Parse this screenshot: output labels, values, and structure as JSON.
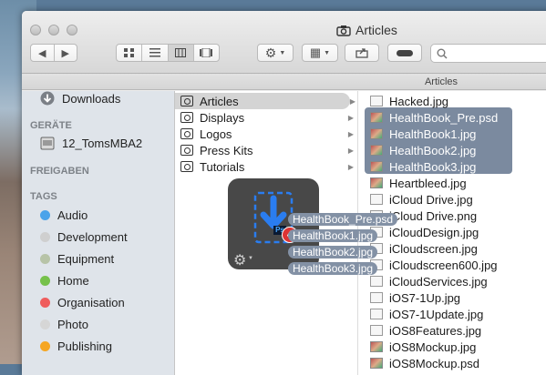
{
  "window": {
    "title": "Articles"
  },
  "toolbar": {
    "back": "◀",
    "forward": "▶",
    "gear": "⚙",
    "arrange": "▦"
  },
  "pathbar": {
    "label": "Articles"
  },
  "sidebar": {
    "top_item": {
      "label": "Downloads",
      "icon": "download-icon"
    },
    "devices_header": "GERÄTE",
    "devices": [
      {
        "label": "12_TomsMBA2",
        "icon": "harddisk-icon"
      }
    ],
    "shared_header": "FREIGABEN",
    "tags_header": "TAGS",
    "tags": [
      {
        "label": "Audio",
        "color": "#4aa3ea"
      },
      {
        "label": "Development",
        "color": "#cfcfcf"
      },
      {
        "label": "Equipment",
        "color": "#b7c3a7"
      },
      {
        "label": "Home",
        "color": "#76c14a"
      },
      {
        "label": "Organisation",
        "color": "#ef5d5d"
      },
      {
        "label": "Photo",
        "color": "#d6d6d6"
      },
      {
        "label": "Publishing",
        "color": "#f5a623"
      }
    ]
  },
  "column1": {
    "items": [
      {
        "label": "Articles",
        "selected": true
      },
      {
        "label": "Displays"
      },
      {
        "label": "Logos"
      },
      {
        "label": "Press Kits"
      },
      {
        "label": "Tutorials"
      }
    ]
  },
  "column2": {
    "items": [
      {
        "label": "Hacked.jpg"
      },
      {
        "label": "HealthBook_Pre.psd",
        "selected": true
      },
      {
        "label": "HealthBook1.jpg",
        "selected": true
      },
      {
        "label": "HealthBook2.jpg",
        "selected": true
      },
      {
        "label": "HealthBook3.jpg",
        "selected": true
      },
      {
        "label": "Heartbleed.jpg"
      },
      {
        "label": "iCloud Drive.jpg"
      },
      {
        "label": "iCloud Drive.png"
      },
      {
        "label": "iCloudDesign.jpg"
      },
      {
        "label": "iCloudscreen.jpg"
      },
      {
        "label": "iCloudscreen600.jpg"
      },
      {
        "label": "iCloudServices.jpg"
      },
      {
        "label": "iOS7-1Up.jpg"
      },
      {
        "label": "iOS7-1Update.jpg"
      },
      {
        "label": "iOS8Features.jpg"
      },
      {
        "label": "iOS8Mockup.jpg"
      },
      {
        "label": "iOS8Mockup.psd"
      }
    ]
  },
  "drag": {
    "count": "4",
    "items": [
      "HealthBook_Pre.psd",
      "HealthBook1.jpg",
      "HealthBook2.jpg",
      "HealthBook3.jpg"
    ],
    "ps_label": "Ps"
  }
}
